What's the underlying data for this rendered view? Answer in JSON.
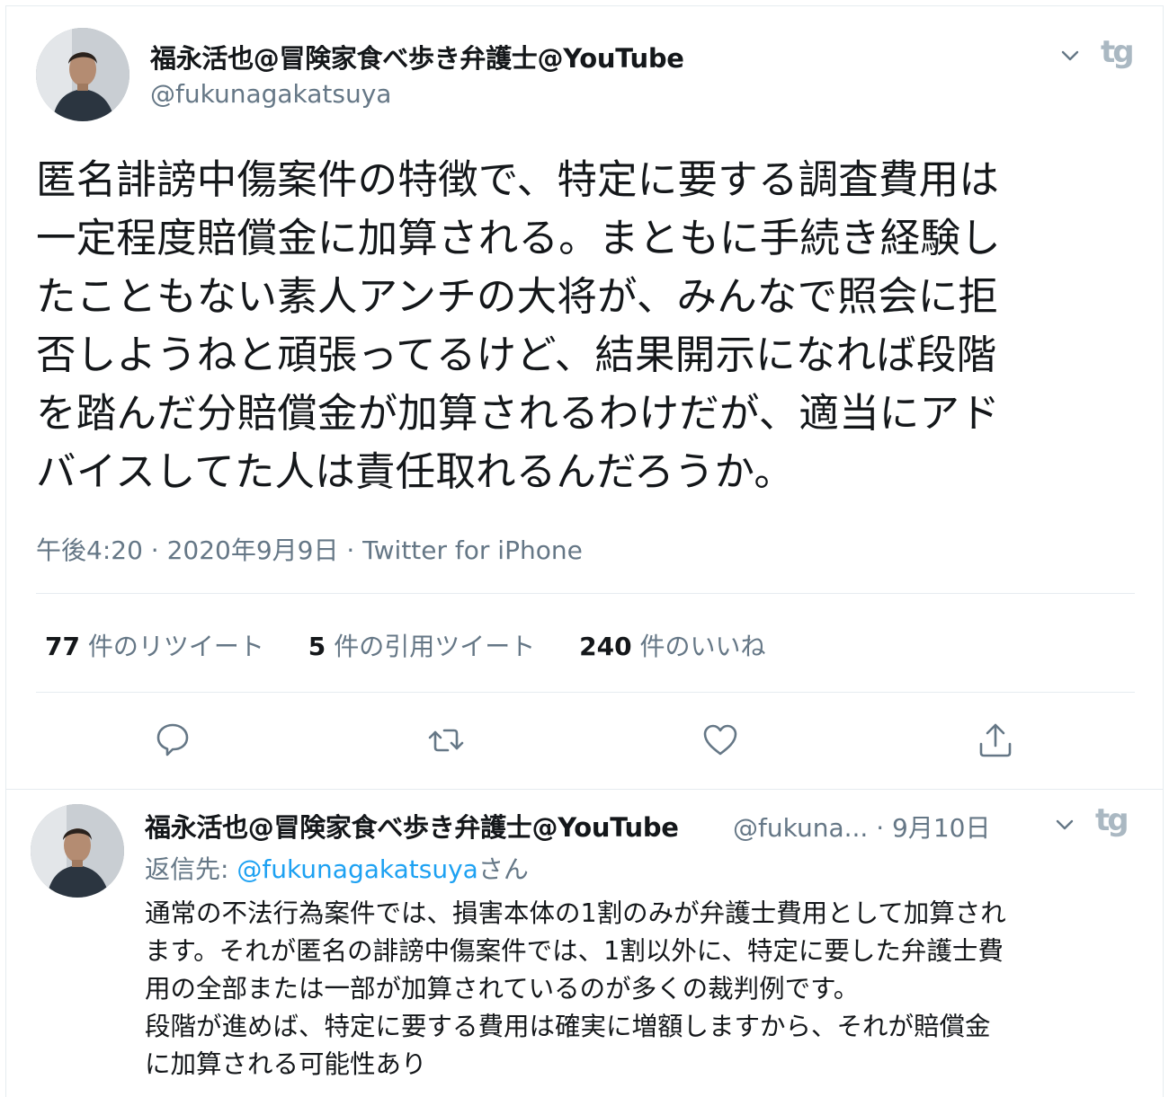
{
  "main_tweet": {
    "display_name": "福永活也@冒険家食べ歩き弁護士@YouTube",
    "handle": "@fukunagakatsuya",
    "text_lines": [
      "匿名誹謗中傷案件の特徴で、特定に要する調査費用は",
      "一定程度賠償金に加算される。まともに手続き経験し",
      "たこともない素人アンチの大将が、みんなで照会に拒",
      "否しようねと頑張ってるけど、結果開示になれば段階",
      "を踏んだ分賠償金が加算されるわけだが、適当にアド",
      "バイスしてた人は責任取れるんだろうか。"
    ],
    "meta": "午後4:20 · 2020年9月9日 · Twitter for iPhone",
    "stats": {
      "retweets_count": "77",
      "retweets_label": "件のリツイート",
      "quotes_count": "5",
      "quotes_label": "件の引用ツイート",
      "likes_count": "240",
      "likes_label": "件のいいね"
    }
  },
  "reply_tweet": {
    "display_name": "福永活也@冒険家食べ歩き弁護士@YouTube",
    "handle_and_date": "@fukuna... · 9月10日",
    "reply_prefix": "返信先: ",
    "reply_mention": "@fukunagakatsuya",
    "reply_suffix": "さん",
    "text_lines": [
      "通常の不法行為案件では、損害本体の1割のみが弁護士費用として加算され",
      "ます。それが匿名の誹謗中傷案件では、1割以外に、特定に要した弁護士費",
      "用の全部または一部が加算されているのが多くの裁判例です。",
      "段階が進めば、特定に要する費用は確実に増額しますから、それが賠償金",
      "に加算される可能性あり"
    ]
  },
  "icons": {
    "logo": "tg",
    "actions": [
      "reply-icon",
      "retweet-icon",
      "like-icon",
      "share-icon"
    ],
    "menu": "chevron-down-icon"
  },
  "colors": {
    "text": "#14171a",
    "secondary": "#657786",
    "link": "#1da1f2",
    "divider": "#e6ecf0",
    "icon": "#657786"
  }
}
